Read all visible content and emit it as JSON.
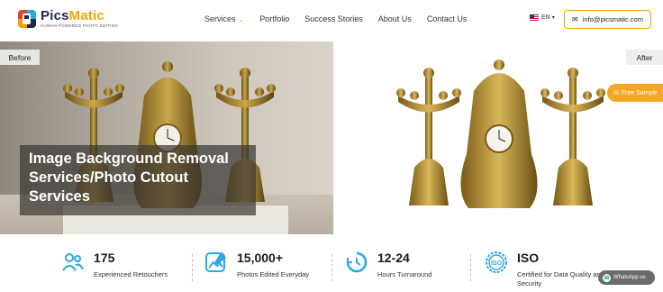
{
  "header": {
    "logo": {
      "name_part1": "Pics",
      "name_part2": "Matic",
      "tagline": "HUMAN-POWERED PHOTO EDITING"
    },
    "nav": [
      {
        "label": "Services",
        "has_dropdown": true
      },
      {
        "label": "Portfolio"
      },
      {
        "label": "Success Stories"
      },
      {
        "label": "About Us"
      },
      {
        "label": "Contact Us"
      }
    ],
    "language": "EN",
    "email": "info@picsmatic.com"
  },
  "hero": {
    "before_label": "Before",
    "after_label": "After",
    "title": "Image Background Removal Services/Photo Cutout Services",
    "free_sample": "Free Sample"
  },
  "stats": [
    {
      "value": "175",
      "label": "Experienced Retouchers",
      "icon": "users-icon"
    },
    {
      "value": "15,000+",
      "label": "Photos Edited Everyday",
      "icon": "photo-edit-icon"
    },
    {
      "value": "12-24",
      "label": "Hours Turnaround",
      "icon": "clock-icon"
    },
    {
      "value": "ISO",
      "label": "Certified for Data Quality and Security",
      "icon": "iso-badge-icon"
    }
  ],
  "whatsapp": {
    "label": "WhatsApp us"
  },
  "colors": {
    "accent": "#f5a000",
    "stat_icon": "#2aa8e0",
    "title_overlay": "#3c3732"
  }
}
